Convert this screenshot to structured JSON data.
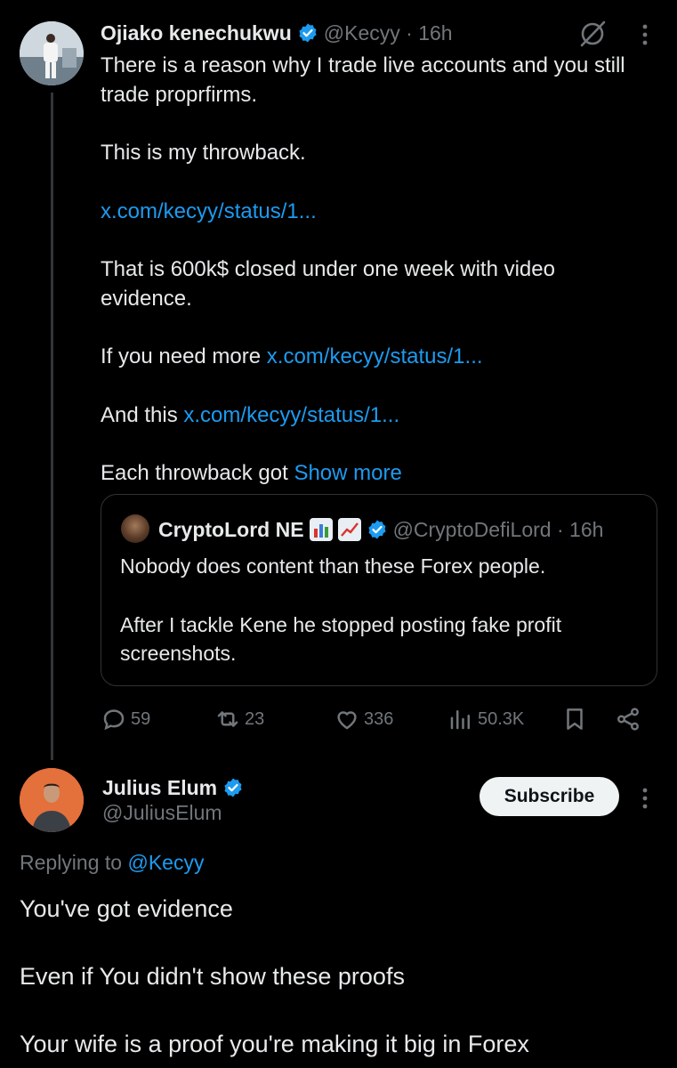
{
  "tweet": {
    "author_name": "Ojiako kenechukwu",
    "handle": "@Kecyy",
    "time": "16h",
    "lines": [
      {
        "text": "There is a reason why I trade live accounts and you still trade proprfirms.",
        "link": ""
      },
      {
        "text": "This is my throwback.",
        "link": ""
      },
      {
        "text": "",
        "link": "x.com/kecyy/status/1..."
      },
      {
        "text": "That is 600k$ closed under one week with video evidence.",
        "link": ""
      },
      {
        "text": "If you need more ",
        "link": "x.com/kecyy/status/1..."
      },
      {
        "text": "And this ",
        "link": "x.com/kecyy/status/1..."
      },
      {
        "text": "Each throwback got ",
        "link": "Show more"
      }
    ],
    "quote": {
      "author_name": "CryptoLord NE",
      "handle": "@CryptoDefiLord",
      "time": "16h",
      "para1": "Nobody does content than these Forex people.",
      "para2": "After I tackle Kene he stopped posting fake profit screenshots."
    },
    "stats": {
      "replies": "59",
      "reposts": "23",
      "likes": "336",
      "views": "50.3K"
    }
  },
  "reply": {
    "author_name": "Julius Elum",
    "handle": "@JuliusElum",
    "subscribe_label": "Subscribe",
    "replying_prefix": "Replying to",
    "replying_to": "@Kecyy",
    "paragraphs": [
      "You've got evidence",
      "Even if You didn't show these proofs",
      "Your wife is a proof you're making it big in Forex"
    ]
  },
  "colors": {
    "background": "#000000",
    "text": "#e7e9ea",
    "secondary": "#71767b",
    "link": "#1d9bf0",
    "verified": "#1d9bf0"
  },
  "icons": [
    "grok-icon",
    "more-icon",
    "verified-icon",
    "reply-icon",
    "repost-icon",
    "like-icon",
    "views-icon",
    "bookmark-icon",
    "share-icon"
  ]
}
